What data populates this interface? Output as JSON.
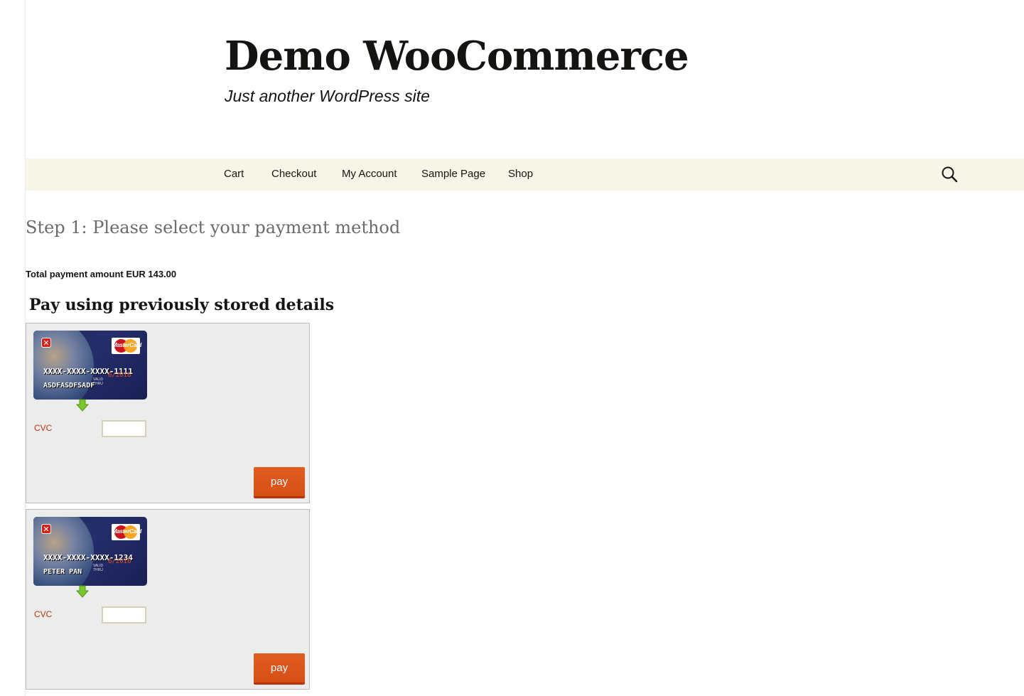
{
  "site": {
    "title": "Demo WooCommerce",
    "tagline": "Just another WordPress site"
  },
  "nav": {
    "items": [
      "Cart",
      "Checkout",
      "My Account",
      "Sample Page",
      "Shop"
    ],
    "search_icon": "search-icon"
  },
  "page": {
    "step_title": "Step 1: Please select your payment method",
    "total": "Total payment amount EUR 143.00",
    "stored_title": "Pay using previously stored details"
  },
  "cards": [
    {
      "number": "XXXX-XXXX-XXXX-1111",
      "name": "ASDFASDFSADF",
      "expiry": "6/2016",
      "valid_thru": "VALID THRU",
      "brand": "MasterCard",
      "cvc_label": "CVC",
      "cvc_value": "",
      "pay_label": "pay"
    },
    {
      "number": "XXXX-XXXX-XXXX-1234",
      "name": "PETER PAN",
      "expiry": "6/2016",
      "valid_thru": "VALID THRU",
      "brand": "MasterCard",
      "cvc_label": "CVC",
      "cvc_value": "",
      "pay_label": "pay"
    }
  ],
  "colors": {
    "nav_bg": "#f7f5e7",
    "accent": "#e05d22",
    "cvc_label": "#bc360a",
    "panel_bg": "#ececec"
  }
}
